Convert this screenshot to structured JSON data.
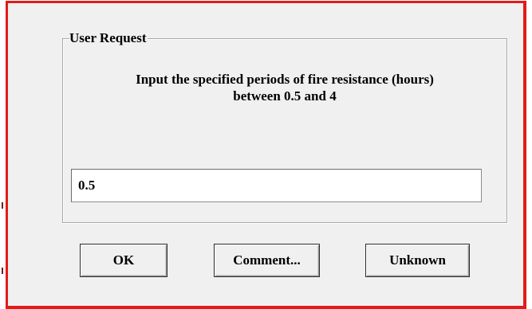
{
  "dialog": {
    "group_title": "User Request",
    "prompt_lines": [
      "Input the specified periods of fire resistance (hours)",
      "between 0.5 and 4"
    ],
    "input_value": "0.5",
    "buttons": {
      "ok": "OK",
      "comment": "Comment...",
      "unknown": "Unknown"
    }
  },
  "colors": {
    "frame_border": "#e11b1b",
    "dialog_background": "#f0f0f0",
    "input_background": "#ffffff"
  }
}
